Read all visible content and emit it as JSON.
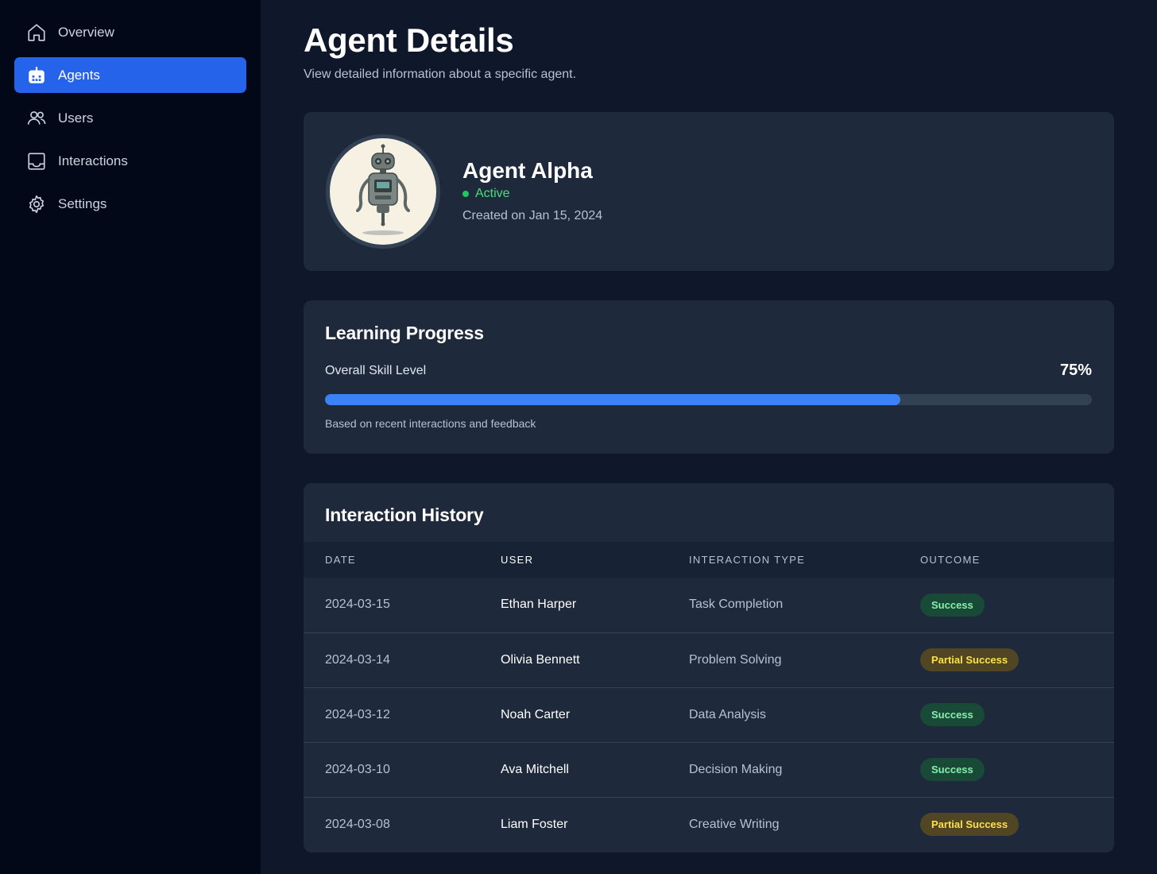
{
  "sidebar": {
    "items": [
      {
        "label": "Overview",
        "icon": "home-icon",
        "active": false
      },
      {
        "label": "Agents",
        "icon": "robot-icon",
        "active": true
      },
      {
        "label": "Users",
        "icon": "users-icon",
        "active": false
      },
      {
        "label": "Interactions",
        "icon": "inbox-icon",
        "active": false
      },
      {
        "label": "Settings",
        "icon": "gear-icon",
        "active": false
      }
    ]
  },
  "header": {
    "title": "Agent Details",
    "subtitle": "View detailed information about a specific agent."
  },
  "agent": {
    "name": "Agent Alpha",
    "status": "Active",
    "created": "Created on Jan 15, 2024",
    "avatar_icon": "robot-avatar"
  },
  "progress": {
    "title": "Learning Progress",
    "label": "Overall Skill Level",
    "value_text": "75%",
    "value": 75,
    "note": "Based on recent interactions and feedback"
  },
  "history": {
    "title": "Interaction History",
    "columns": [
      "DATE",
      "USER",
      "INTERACTION TYPE",
      "OUTCOME"
    ],
    "rows": [
      {
        "date": "2024-03-15",
        "user": "Ethan Harper",
        "type": "Task Completion",
        "outcome": "Success"
      },
      {
        "date": "2024-03-14",
        "user": "Olivia Bennett",
        "type": "Problem Solving",
        "outcome": "Partial Success"
      },
      {
        "date": "2024-03-12",
        "user": "Noah Carter",
        "type": "Data Analysis",
        "outcome": "Success"
      },
      {
        "date": "2024-03-10",
        "user": "Ava Mitchell",
        "type": "Decision Making",
        "outcome": "Success"
      },
      {
        "date": "2024-03-08",
        "user": "Liam Foster",
        "type": "Creative Writing",
        "outcome": "Partial Success"
      }
    ]
  },
  "colors": {
    "accent": "#2563eb",
    "success": "#86efac",
    "partial": "#fde047",
    "active": "#4ade80"
  }
}
